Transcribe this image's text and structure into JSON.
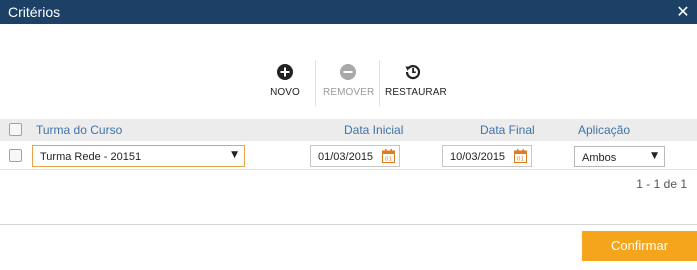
{
  "dialog": {
    "title": "Critérios",
    "close_icon": "close-icon"
  },
  "toolbar": {
    "new_label": "NOVO",
    "remove_label": "REMOVER",
    "restore_label": "RESTAURAR",
    "new_icon": "plus-circle-icon",
    "remove_icon": "minus-circle-icon",
    "restore_icon": "history-icon"
  },
  "grid": {
    "columns": [
      "Turma do Curso",
      "Data Inicial",
      "Data Final",
      "Aplicação"
    ],
    "rows": [
      {
        "turma": "Turma Rede - 20151",
        "data_inicial": "01/03/2015",
        "data_final": "10/03/2015",
        "aplicacao": "Ambos"
      }
    ],
    "pager": "1 - 1 de 1"
  },
  "footer": {
    "confirm_label": "Confirmar"
  },
  "colors": {
    "titlebar": "#1c4066",
    "header_text": "#3f73a8",
    "confirm_bg": "#f5a51c",
    "active_border": "#e8a44c"
  }
}
